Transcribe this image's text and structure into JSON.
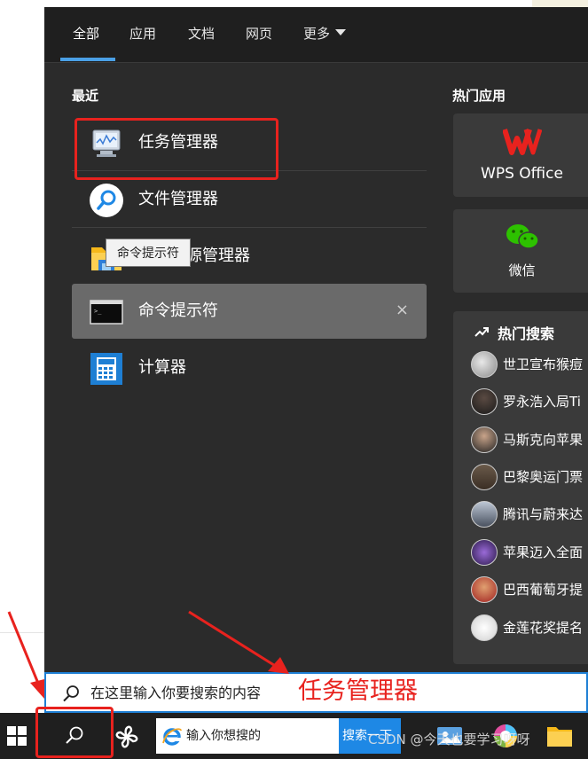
{
  "tabs": [
    {
      "label": "全部"
    },
    {
      "label": "应用"
    },
    {
      "label": "文档"
    },
    {
      "label": "网页"
    },
    {
      "label": "更多"
    }
  ],
  "recent": {
    "title": "最近",
    "items": [
      {
        "label": "任务管理器",
        "icon": "task-manager-icon"
      },
      {
        "label": "文件管理器",
        "icon": "file-manager-search-icon"
      },
      {
        "label": "文件资源管理器",
        "icon": "folder-icon"
      },
      {
        "label": "命令提示符",
        "icon": "cmd-icon",
        "remove": "×"
      },
      {
        "label": "计算器",
        "icon": "calculator-icon"
      }
    ],
    "tooltip": "命令提示符"
  },
  "hot_apps": {
    "title": "热门应用",
    "items": [
      {
        "label": "WPS Office",
        "icon": "wps-icon"
      },
      {
        "label": "微信",
        "icon": "wechat-icon"
      }
    ]
  },
  "hot_search": {
    "title": "热门搜索",
    "items": [
      {
        "text": "世卫宣布猴痘"
      },
      {
        "text": "罗永浩入局Ti"
      },
      {
        "text": "马斯克向苹果"
      },
      {
        "text": "巴黎奥运门票"
      },
      {
        "text": "腾讯与蔚来达"
      },
      {
        "text": "苹果迈入全面"
      },
      {
        "text": "巴西葡萄牙提"
      },
      {
        "text": "金莲花奖提名"
      }
    ]
  },
  "search": {
    "placeholder": "在这里输入你要搜索的内容",
    "annotation": "任务管理器"
  },
  "taskbar": {
    "browser_text": "输入你想搜的",
    "search_button": "搜索一下",
    "watermark": "CSDN @今天也要学习呀呀"
  },
  "colors": {
    "panel_bg": "#2b2b2b",
    "accent": "#4aa0e6",
    "annotation_red": "#e8221e",
    "search_border": "#1e7fd4"
  }
}
